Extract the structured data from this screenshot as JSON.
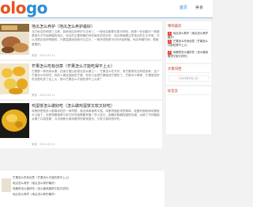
{
  "header": {
    "logo_part1": "olo",
    "logo_part2": "go",
    "nav": [
      "首页",
      "美食"
    ]
  },
  "posts": [
    {
      "title": "地瓜怎么养护（地瓜怎么养护最好）",
      "excerpt": "北方地瓜的种类三五种，各种地瓜的养护方法有三，一般地瓜都是在夏天种的，就是一年到春天一般都是夏天才开始种植的地瓜，地瓜的主要种植时间在每年的四月份，地瓜种植要注意地瓜的生长环境，可以说是比较好种植的，只要温度适宜就可以生长。一般来说就是3月份开始种植，地瓜种植时间，是最重要的。",
      "meta": "美食  ·  2023-03-12"
    },
    {
      "title": "芒果怎么吃有创意（芒果怎么才能吃得不上火）",
      "excerpt": "芒果是一种热带水果，在南方是比较常见的水果之一，芒果怎么吃才好，有芒果的吃法有很多种，这个芒果怎么吃好吃，有的人喜欢直接吃芒果，有的人会把芒果做成芒果布丁、芒果冰沙等等，芒果虽然好吃但是吃多了会上火，那么芒果怎么才能吃得不上火呢？",
      "meta": "美食  ·  2023-03-11"
    },
    {
      "title": "鸡蛋饼怎么做好吃（怎么做鸡蛋饼又软又好吃）",
      "excerpt": "鸡蛋饼是很多人都喜欢吃的一种早餐，做法简单营养丰富，鸡蛋饼做起来很简单，准备好面粉和鸡蛋就可以做了，但是想要做得又软又好吃就需要掌握一些小技巧，面糊的稀稠程度很关键，太稀了不好翻面太稠了口感发硬，今天就教大家鸡蛋饼的家常做法，又软又香特别好吃。",
      "meta": "美食  ·  2023-03-10"
    }
  ],
  "sidebar": {
    "hot_title": "猜你喜欢",
    "hot_items": [
      {
        "num": "1",
        "text": "地瓜怎么养护（地瓜怎么养护最好）"
      },
      {
        "num": "2",
        "text": "芒果怎么吃有创意（芒果怎么才能吃得不上火）"
      },
      {
        "num": "3",
        "text": "鸡蛋饼怎么做好吃（怎么做鸡蛋饼又软又好吃）"
      }
    ],
    "date_title": "文章归档",
    "date_value": "2023年3月 (3)",
    "tags_title": "标签云"
  },
  "bottom": {
    "lines": [
      "芒果怎么吃有创意（芒果怎么才能吃得不上火）",
      "地瓜怎么养护（地瓜怎么养护最好）",
      "鸡蛋饼怎么做好吃（怎么做鸡蛋饼又软又好吃）",
      "地瓜怎么养护（地瓜怎么养护最好）"
    ]
  },
  "colors": {
    "accent_blue": "#2a84d4",
    "accent_orange": "#e9521d",
    "hot_red": "#e74c3c"
  }
}
